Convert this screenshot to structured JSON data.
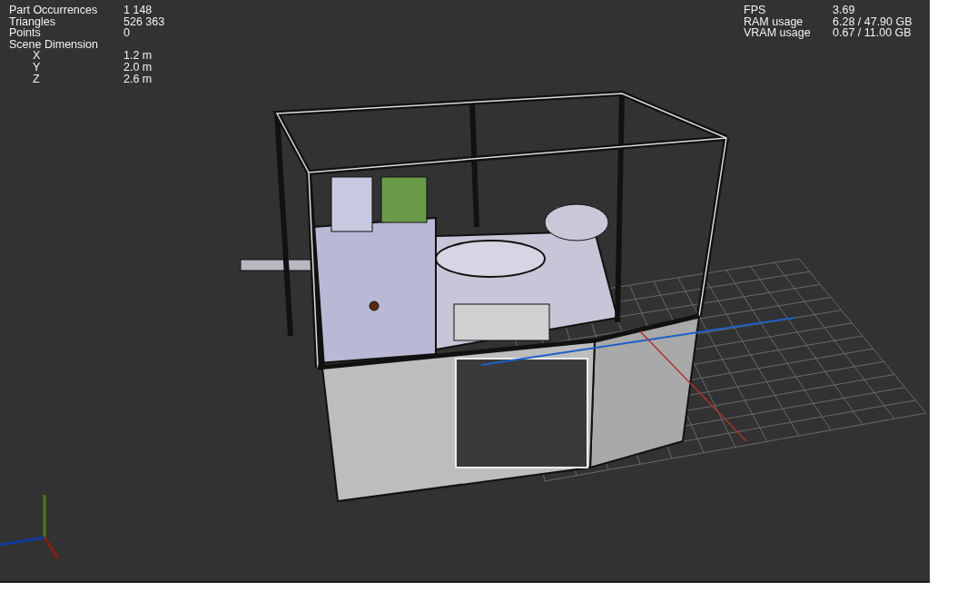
{
  "scene_stats": [
    {
      "label": "Part Occurrences",
      "value": "1 148"
    },
    {
      "label": "Triangles",
      "value": "526 363"
    },
    {
      "label": "Points",
      "value": "0"
    },
    {
      "label": "Scene Dimension",
      "children": [
        {
          "label": "X",
          "value": "1.2 m"
        },
        {
          "label": "Y",
          "value": "2.0 m"
        },
        {
          "label": "Z",
          "value": "2.6 m"
        }
      ]
    }
  ],
  "performance_stats": [
    {
      "label": "FPS",
      "value": "3.69"
    },
    {
      "label": "RAM usage",
      "value": "6.28 / 47.90 GB"
    },
    {
      "label": "VRAM usage",
      "value": "0.67 / 11.00 GB"
    }
  ]
}
